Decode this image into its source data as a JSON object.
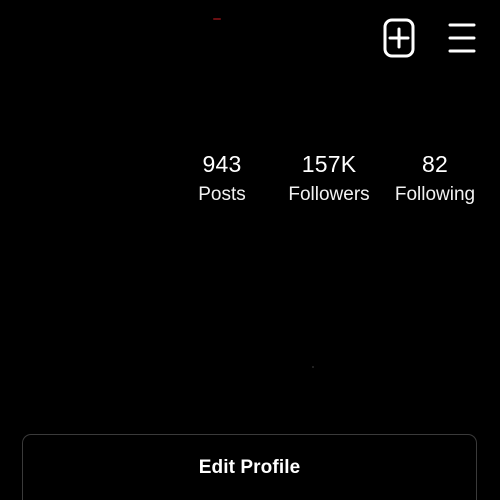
{
  "header": {
    "icons": {
      "new_post": "plus-square-icon",
      "menu": "hamburger-menu-icon"
    }
  },
  "stats": {
    "posts": {
      "value": "943",
      "label": "Posts"
    },
    "followers": {
      "value": "157K",
      "label": "Followers"
    },
    "following": {
      "value": "82",
      "label": "Following"
    }
  },
  "actions": {
    "edit_profile_label": "Edit Profile"
  },
  "colors": {
    "background": "#000000",
    "text": "#ffffff",
    "button_border": "#3a3a3a"
  }
}
